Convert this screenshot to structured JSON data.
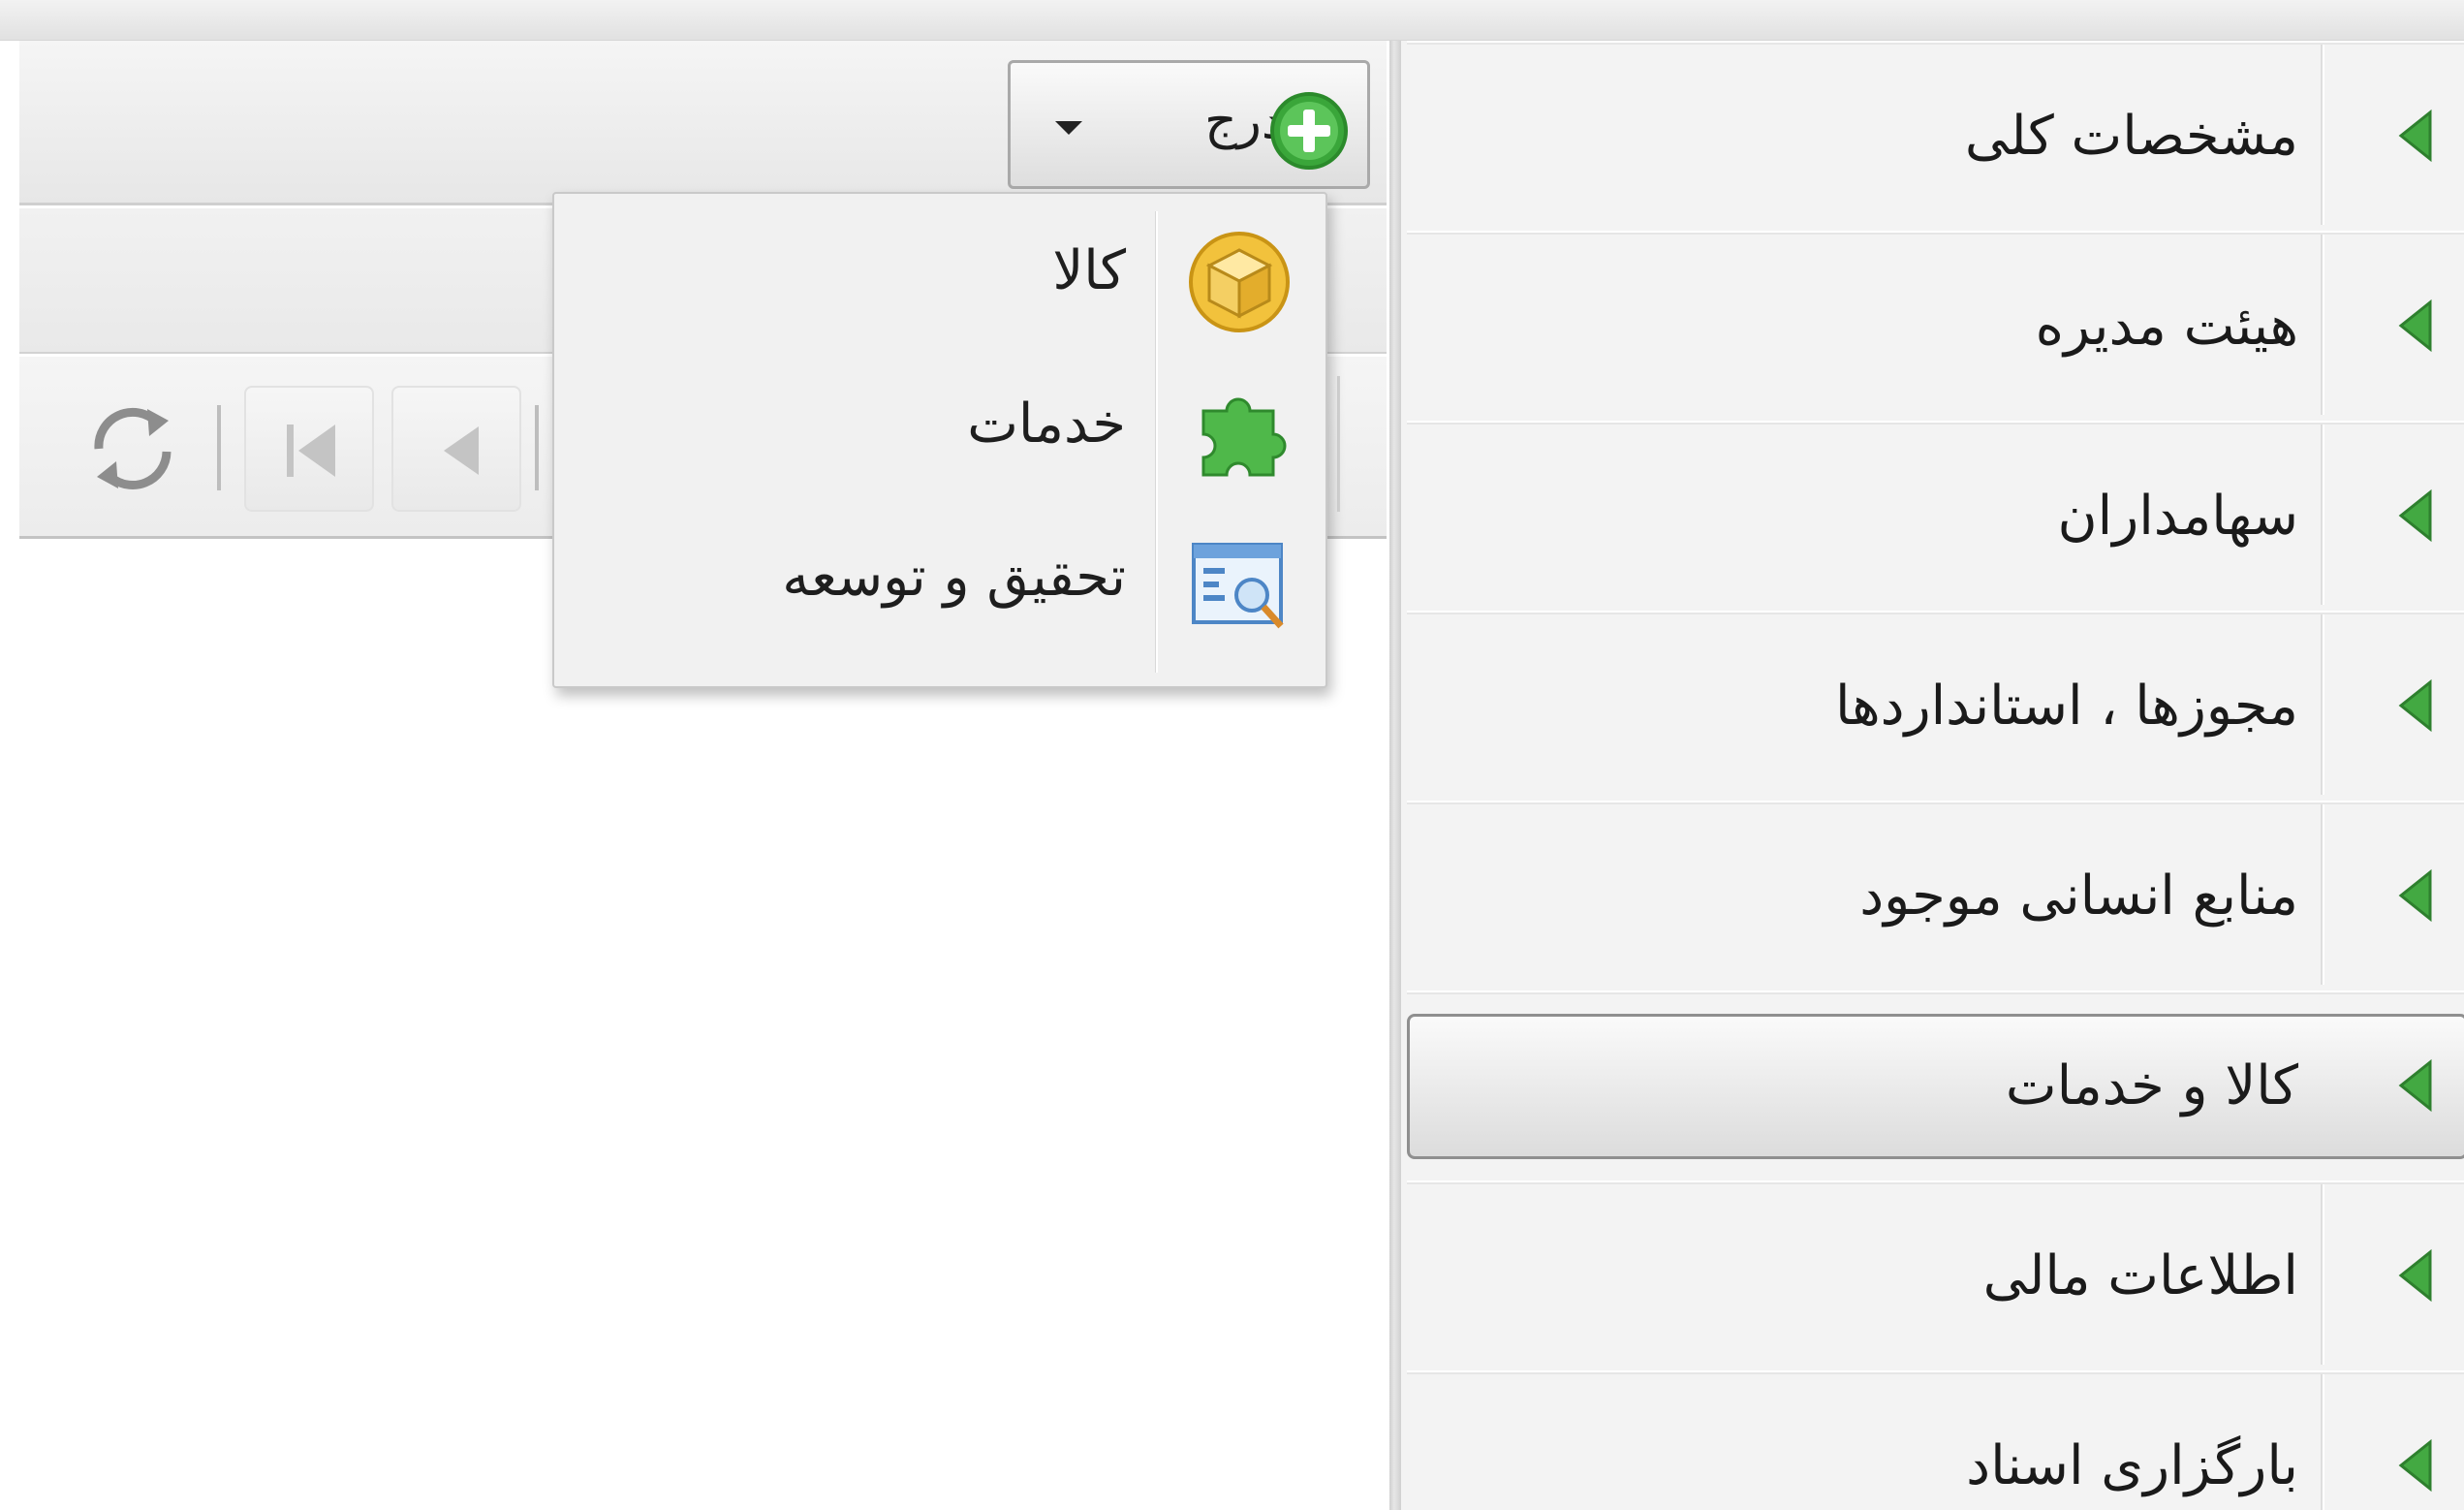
{
  "toolbar": {
    "insert_label": "درج"
  },
  "insert_menu": {
    "items": [
      {
        "label": "کالا",
        "icon": "box-icon"
      },
      {
        "label": "خدمات",
        "icon": "puzzle-icon"
      },
      {
        "label": "تحقیق و توسعه",
        "icon": "search-window-icon"
      }
    ]
  },
  "pager": {
    "icons": [
      "refresh-icon",
      "first-page-icon",
      "previous-page-icon"
    ]
  },
  "sidebar": {
    "selected_index": 5,
    "items": [
      {
        "label": "مشخصات کلی"
      },
      {
        "label": "هیئت مدیره"
      },
      {
        "label": "سهامداران"
      },
      {
        "label": "مجوزها ، استانداردها"
      },
      {
        "label": "منابع انسانی موجود"
      },
      {
        "label": "کالا و خدمات"
      },
      {
        "label": "اطلاعات مالی"
      },
      {
        "label": "بارگزاری اسناد"
      }
    ]
  },
  "colors": {
    "accent_green": "#3aa63a",
    "selected_border": "#8f8f8f",
    "panel_bg": "#f3f3f3"
  }
}
